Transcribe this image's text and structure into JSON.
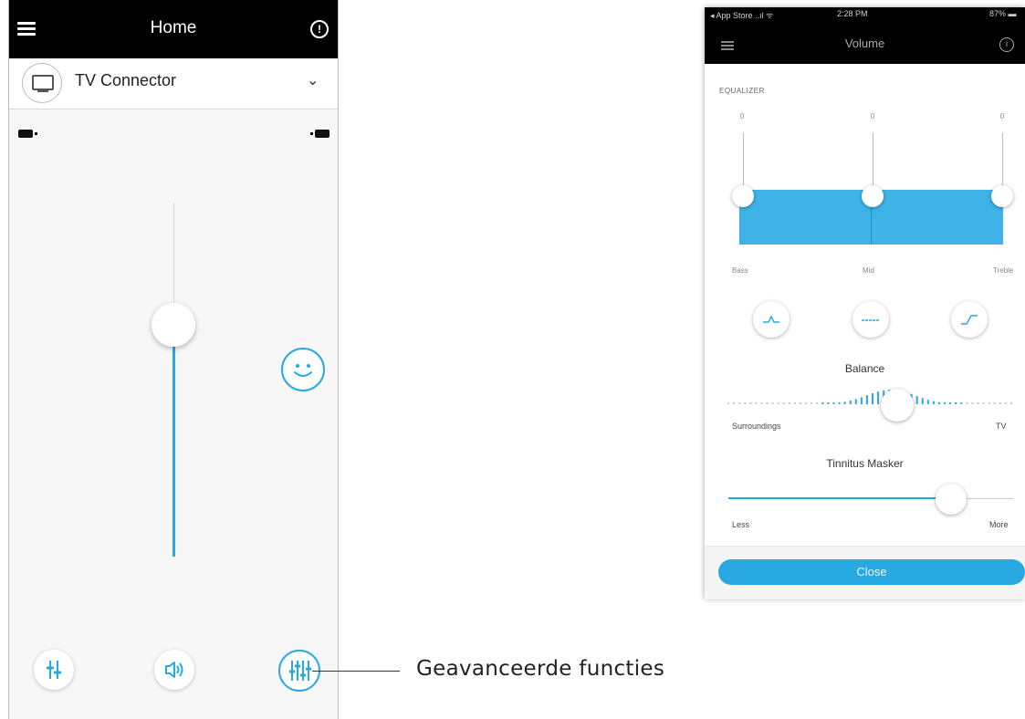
{
  "left_screen": {
    "header": {
      "title": "Home"
    },
    "device": {
      "name": "TV Connector"
    },
    "volume_level": 0.62,
    "callout": "Geavanceerde functies"
  },
  "right_screen": {
    "status_bar": {
      "carrier": "◂ App Store ..ıl ᯤ",
      "time": "2:28 PM",
      "battery": "87% ▬"
    },
    "header": {
      "title": "Volume"
    },
    "equalizer": {
      "label": "EQUALIZER",
      "bands": [
        {
          "name": "Bass",
          "value": "0"
        },
        {
          "name": "Mid",
          "value": "0"
        },
        {
          "name": "Treble",
          "value": "0"
        }
      ]
    },
    "balance": {
      "title": "Balance",
      "left_label": "Surroundings",
      "right_label": "TV"
    },
    "tinnitus": {
      "title": "Tinnitus Masker",
      "left_label": "Less",
      "right_label": "More",
      "level": 0.78
    },
    "close_label": "Close"
  },
  "colors": {
    "accent": "#29a9e1",
    "header": "#000000"
  }
}
